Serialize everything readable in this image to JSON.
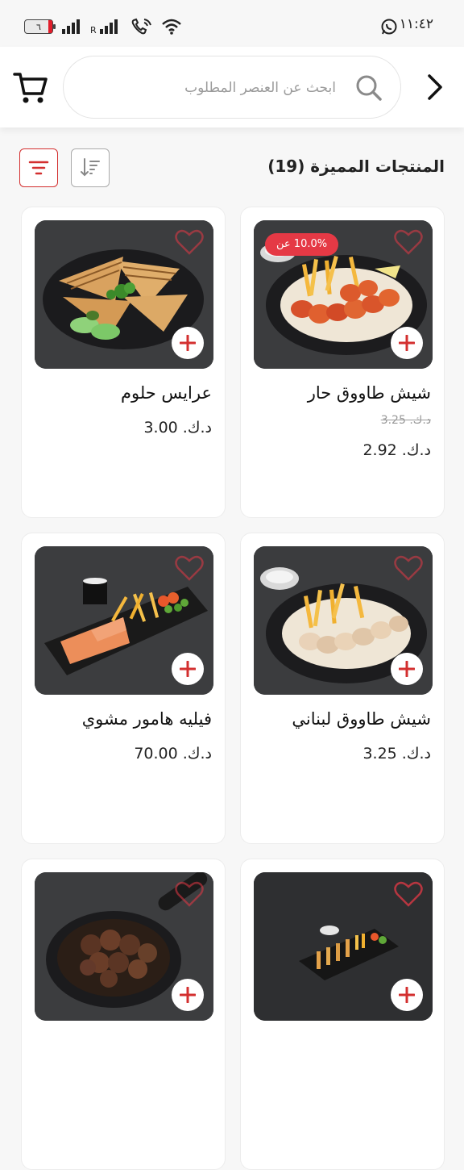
{
  "status_bar": {
    "time": "١١:٤٢",
    "battery": "٦"
  },
  "header": {
    "search_placeholder": "ابحث عن العنصر المطلوب"
  },
  "section": {
    "title": "المنتجات المميزة (19)"
  },
  "products": [
    {
      "name": "شيش طاووق حار",
      "old_price": "د.ك. 3.25",
      "price": "د.ك. 2.92",
      "discount": "10.0% عن",
      "dish": "chicken-spicy"
    },
    {
      "name": "عرايس حلوم",
      "price": "د.ك. 3.00",
      "dish": "arayes"
    },
    {
      "name": "شيش طاووق لبناني",
      "price": "د.ك. 3.25",
      "dish": "chicken"
    },
    {
      "name": "فيليه هامور مشوي",
      "price": "د.ك. 70.00",
      "dish": "fish"
    },
    {
      "name": "",
      "price": "",
      "dish": "skewers"
    },
    {
      "name": "",
      "price": "",
      "dish": "meat-pan"
    }
  ],
  "colors": {
    "accent": "#d32f2f",
    "discount_badge": "#e53945"
  }
}
